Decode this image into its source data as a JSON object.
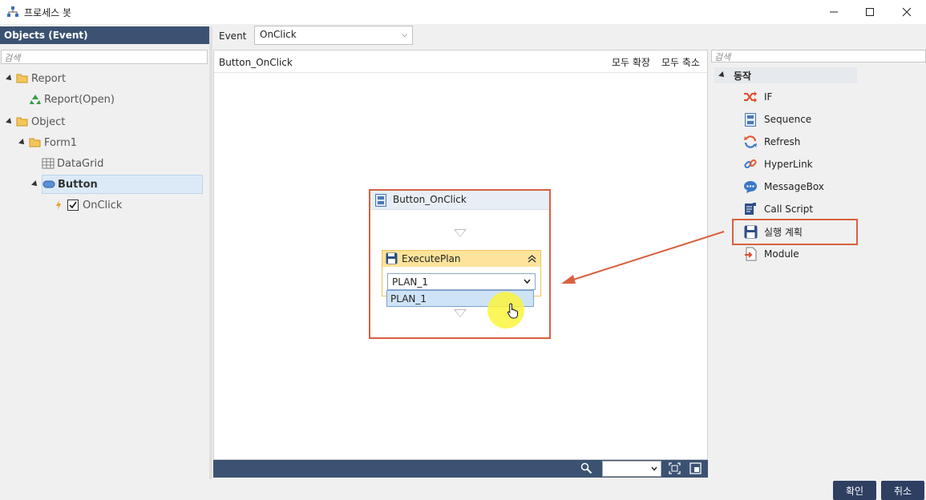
{
  "window": {
    "title": "프로세스 봇"
  },
  "left": {
    "header": "Objects (Event)",
    "search_placeholder": "검색",
    "tree": {
      "report": "Report",
      "report_open": "Report(Open)",
      "object": "Object",
      "form1": "Form1",
      "datagrid": "DataGrid",
      "button": "Button",
      "onclick": "OnClick"
    }
  },
  "center": {
    "event_label": "Event",
    "event_value": "OnClick",
    "canvas_title": "Button_OnClick",
    "expand_all": "모두 확장",
    "collapse_all": "모두 축소",
    "flow": {
      "title": "Button_OnClick",
      "step_title": "ExecutePlan",
      "plan_value": "PLAN_1",
      "plan_option": "PLAN_1"
    }
  },
  "right": {
    "search_placeholder": "검색",
    "group": "동작",
    "actions": [
      {
        "label": "IF",
        "icon": "shuffle-icon"
      },
      {
        "label": "Sequence",
        "icon": "sequence-icon"
      },
      {
        "label": "Refresh",
        "icon": "refresh-icon"
      },
      {
        "label": "HyperLink",
        "icon": "link-icon"
      },
      {
        "label": "MessageBox",
        "icon": "message-icon"
      },
      {
        "label": "Call Script",
        "icon": "script-icon"
      },
      {
        "label": "실행 계획",
        "icon": "save-icon"
      },
      {
        "label": "Module",
        "icon": "module-icon"
      }
    ]
  },
  "footer": {
    "ok": "확인",
    "cancel": "취소"
  },
  "colors": {
    "accent": "#3b5272",
    "highlight": "#d9603f",
    "step_header": "#fde49a"
  }
}
